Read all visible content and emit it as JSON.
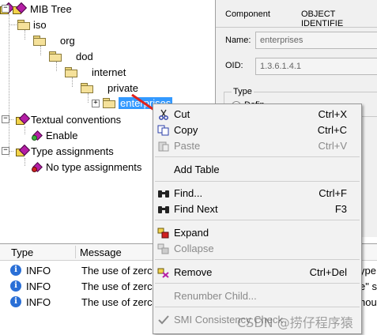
{
  "tree": {
    "root": "MIB Tree",
    "iso": "iso",
    "org": "org",
    "dod": "dod",
    "internet": "internet",
    "private": "private",
    "enterprises": "enterprises",
    "textual": "Textual conventions",
    "enable": "Enable",
    "type_assign": "Type assignments",
    "no_type": "No type assignments"
  },
  "panel": {
    "component_label": "Component",
    "component_value": "OBJECT IDENTIFIE",
    "name_label": "Name:",
    "name_value": "enterprises",
    "oid_label": "OID:",
    "oid_value": "1.3.6.1.4.1",
    "type_label": "Type",
    "type_option": "Defin"
  },
  "log": {
    "col_type": "Type",
    "col_message": "Message",
    "rows": [
      {
        "type": "INFO",
        "message": "The use of zerc",
        "tail": "ype"
      },
      {
        "type": "INFO",
        "message": "The use of zerc",
        "tail": "e\" s"
      },
      {
        "type": "INFO",
        "message": "The use of zerc",
        "tail": "houl"
      }
    ]
  },
  "menu": {
    "cut": {
      "label": "Cut",
      "shortcut": "Ctrl+X",
      "icon": "scissors-icon"
    },
    "copy": {
      "label": "Copy",
      "shortcut": "Ctrl+C",
      "icon": "copy-icon"
    },
    "paste": {
      "label": "Paste",
      "shortcut": "Ctrl+V",
      "icon": "paste-icon"
    },
    "add_table": {
      "label": "Add Table"
    },
    "find": {
      "label": "Find...",
      "shortcut": "Ctrl+F",
      "icon": "binoculars-icon"
    },
    "find_next": {
      "label": "Find Next",
      "shortcut": "F3",
      "icon": "binoculars-next-icon"
    },
    "expand": {
      "label": "Expand",
      "icon": "expand-icon"
    },
    "collapse": {
      "label": "Collapse",
      "icon": "collapse-icon"
    },
    "remove": {
      "label": "Remove",
      "shortcut": "Ctrl+Del",
      "icon": "remove-icon"
    },
    "renumber": {
      "label": "Renumber Child..."
    },
    "smi": {
      "label": "SMI Consistency Check",
      "icon": "check-icon"
    }
  },
  "watermark": "CSDN @捞仔程序猿",
  "colors": {
    "selection": "#3399ff",
    "arrow": "#e0221c",
    "menu_bg": "#f2f2f2"
  }
}
